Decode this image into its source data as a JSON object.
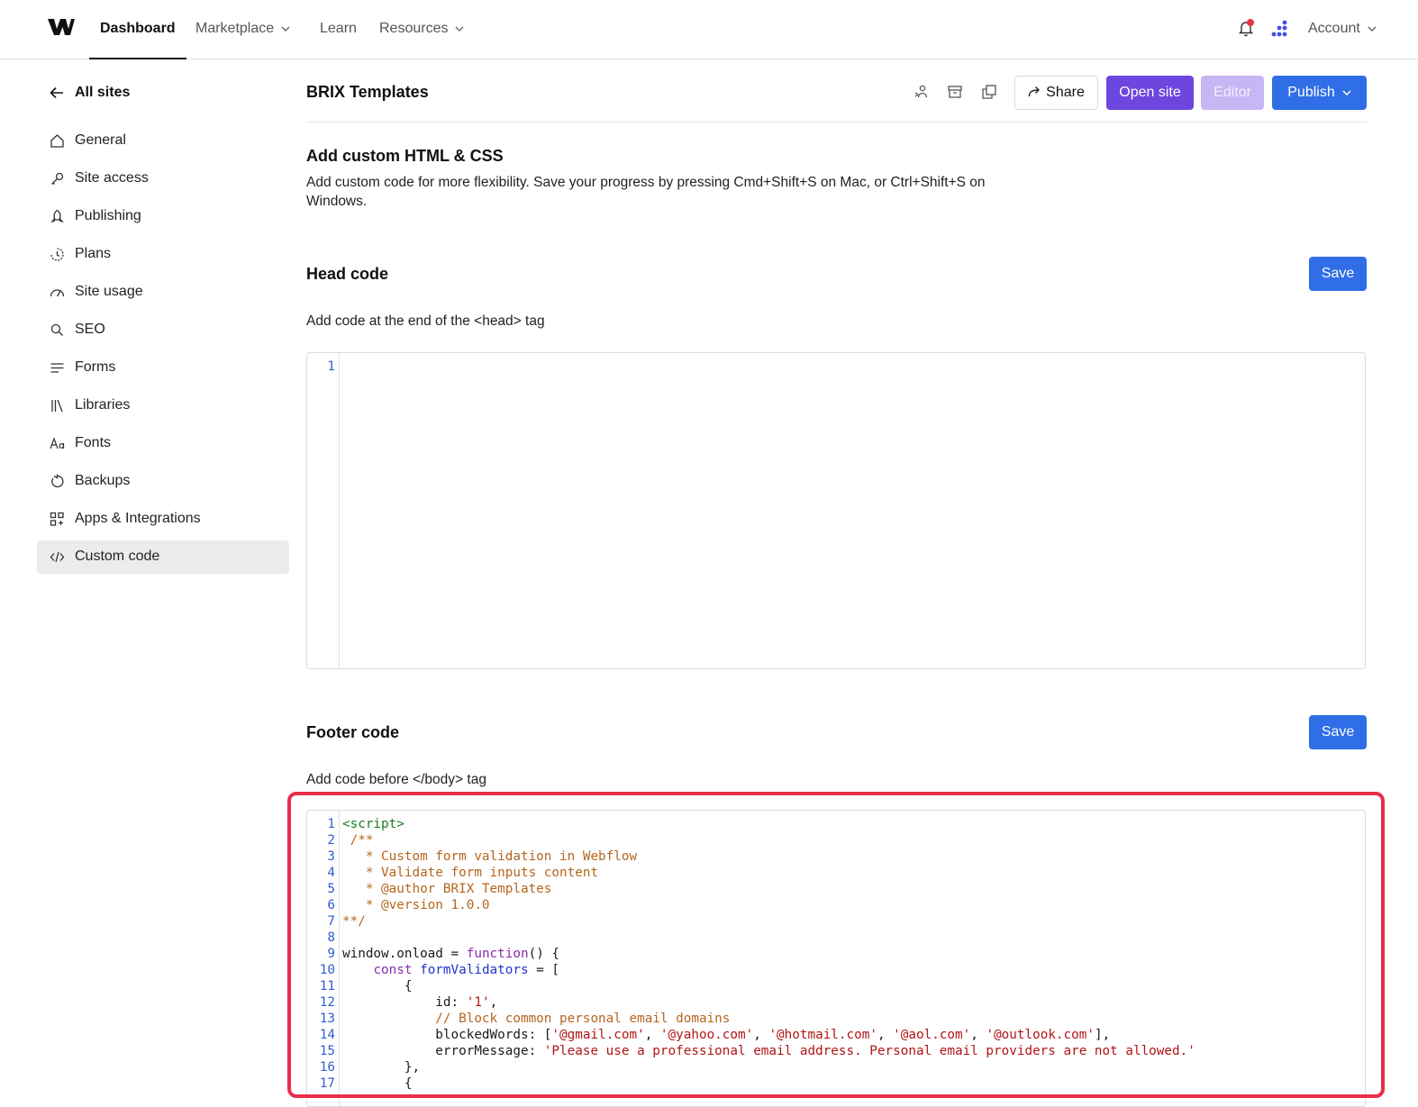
{
  "topnav": {
    "items": [
      {
        "label": "Dashboard",
        "active": true
      },
      {
        "label": "Marketplace",
        "dropdown": true
      },
      {
        "label": "Learn"
      },
      {
        "label": "Resources",
        "dropdown": true
      }
    ],
    "account_label": "Account"
  },
  "sidebar": {
    "back_label": "All sites",
    "items": [
      {
        "label": "General",
        "icon": "home-icon"
      },
      {
        "label": "Site access",
        "icon": "key-icon"
      },
      {
        "label": "Publishing",
        "icon": "rocket-icon"
      },
      {
        "label": "Plans",
        "icon": "plans-icon"
      },
      {
        "label": "Site usage",
        "icon": "gauge-icon"
      },
      {
        "label": "SEO",
        "icon": "search-icon"
      },
      {
        "label": "Forms",
        "icon": "forms-icon"
      },
      {
        "label": "Libraries",
        "icon": "libraries-icon"
      },
      {
        "label": "Fonts",
        "icon": "fonts-icon"
      },
      {
        "label": "Backups",
        "icon": "backup-icon"
      },
      {
        "label": "Apps & Integrations",
        "icon": "apps-integrations-icon"
      },
      {
        "label": "Custom code",
        "icon": "code-icon",
        "active": true
      }
    ]
  },
  "header": {
    "site_title": "BRIX Templates",
    "share_label": "Share",
    "open_site_label": "Open site",
    "editor_label": "Editor",
    "publish_label": "Publish"
  },
  "intro": {
    "title": "Add custom HTML & CSS",
    "description": "Add custom code for more flexibility. Save your progress by pressing Cmd+Shift+S on Mac, or Ctrl+Shift+S on Windows."
  },
  "head_code": {
    "title": "Head code",
    "description": "Add code at the end of the <head> tag",
    "save_label": "Save",
    "line_numbers": [
      "1"
    ]
  },
  "footer_code": {
    "title": "Footer code",
    "description": "Add code before </body> tag",
    "save_label": "Save",
    "lines": [
      [
        {
          "t": "tag",
          "v": "<script>"
        }
      ],
      [
        {
          "t": "com",
          "v": " /**"
        }
      ],
      [
        {
          "t": "com",
          "v": "   * Custom form validation in Webflow"
        }
      ],
      [
        {
          "t": "com",
          "v": "   * Validate form inputs content"
        }
      ],
      [
        {
          "t": "com",
          "v": "   * @author BRIX Templates"
        }
      ],
      [
        {
          "t": "com",
          "v": "   * @version 1.0.0"
        }
      ],
      [
        {
          "t": "com",
          "v": "**/"
        }
      ],
      [],
      [
        {
          "t": "txt",
          "v": "window.onload = "
        },
        {
          "t": "kw",
          "v": "function"
        },
        {
          "t": "txt",
          "v": "() {"
        }
      ],
      [
        {
          "t": "txt",
          "v": "    "
        },
        {
          "t": "kw",
          "v": "const"
        },
        {
          "t": "txt",
          "v": " "
        },
        {
          "t": "dec",
          "v": "formValidators"
        },
        {
          "t": "txt",
          "v": " = ["
        }
      ],
      [
        {
          "t": "txt",
          "v": "        {"
        }
      ],
      [
        {
          "t": "txt",
          "v": "            id: "
        },
        {
          "t": "str",
          "v": "'1'"
        },
        {
          "t": "txt",
          "v": ","
        }
      ],
      [
        {
          "t": "com",
          "v": "            // Block common personal email domains"
        }
      ],
      [
        {
          "t": "txt",
          "v": "            blockedWords: ["
        },
        {
          "t": "str",
          "v": "'@gmail.com'"
        },
        {
          "t": "txt",
          "v": ", "
        },
        {
          "t": "str",
          "v": "'@yahoo.com'"
        },
        {
          "t": "txt",
          "v": ", "
        },
        {
          "t": "str",
          "v": "'@hotmail.com'"
        },
        {
          "t": "txt",
          "v": ", "
        },
        {
          "t": "str",
          "v": "'@aol.com'"
        },
        {
          "t": "txt",
          "v": ", "
        },
        {
          "t": "str",
          "v": "'@outlook.com'"
        },
        {
          "t": "txt",
          "v": "],"
        }
      ],
      [
        {
          "t": "txt",
          "v": "            errorMessage: "
        },
        {
          "t": "str",
          "v": "'Please use a professional email address. Personal email providers are not allowed.'"
        }
      ],
      [
        {
          "t": "txt",
          "v": "        },"
        }
      ],
      [
        {
          "t": "txt",
          "v": "        {"
        }
      ]
    ]
  },
  "colors": {
    "accent_blue": "#2f6ee6",
    "accent_purple": "#6d46e0",
    "editor_disabled": "#c6b6f3",
    "highlight_red": "#ea2d4a"
  }
}
